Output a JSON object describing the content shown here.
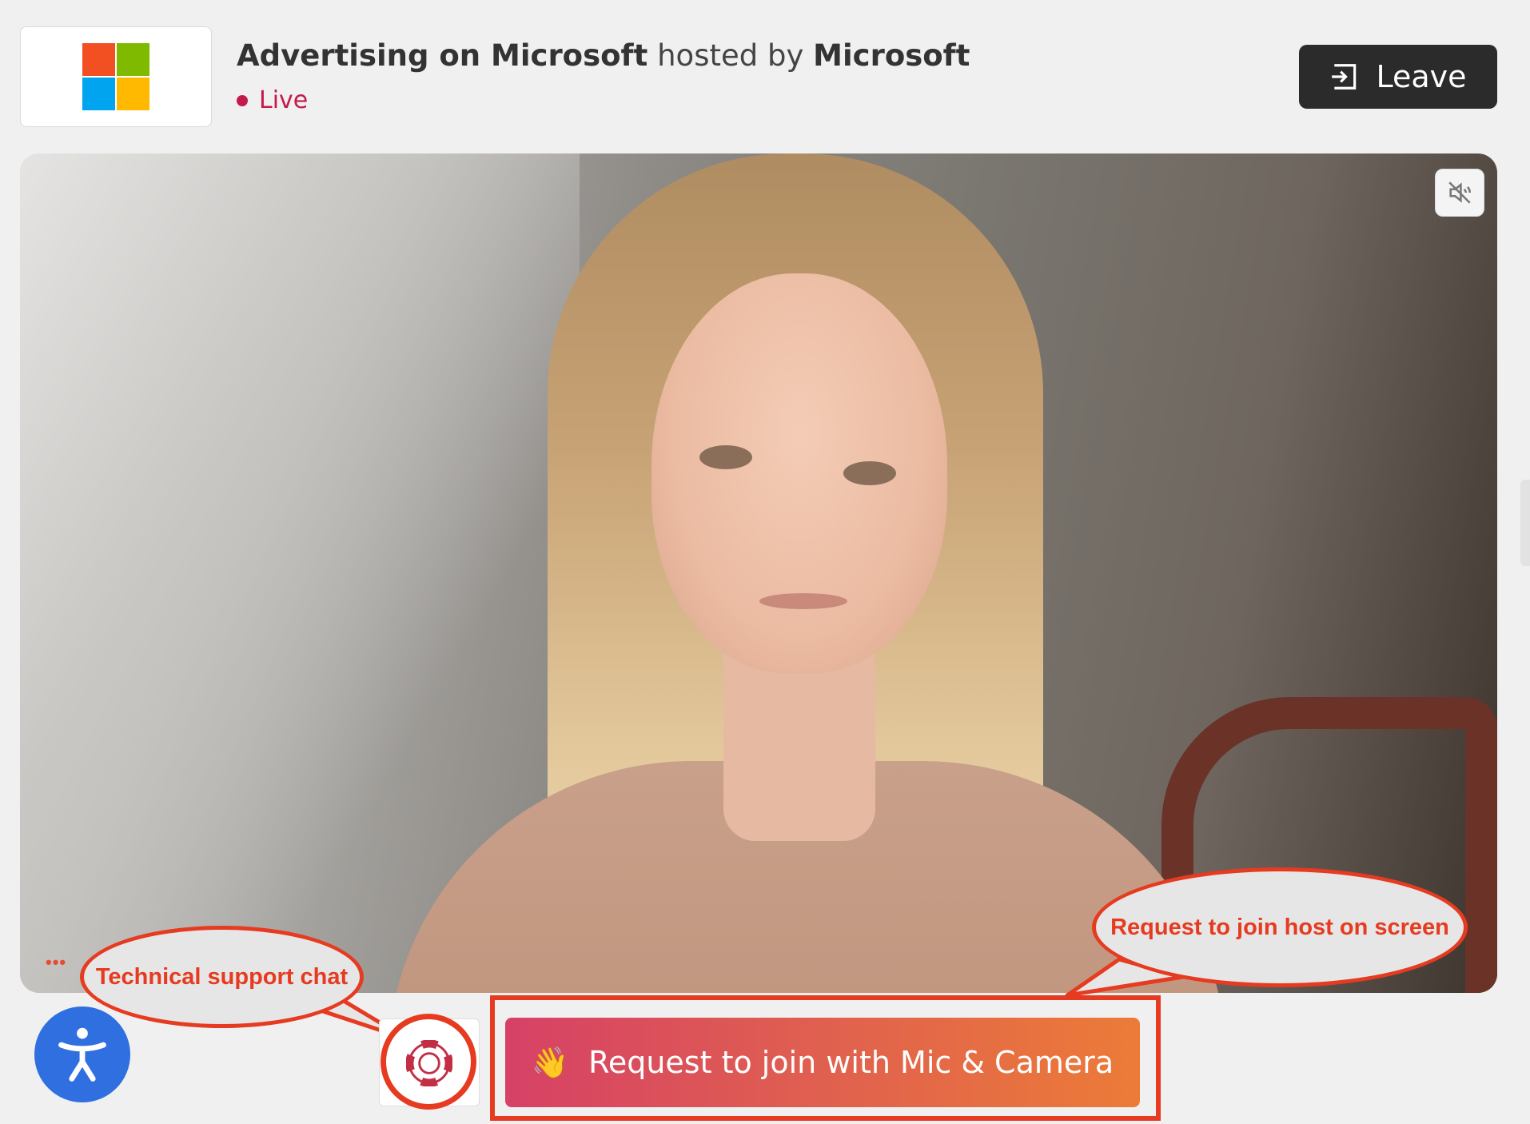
{
  "header": {
    "event_title": "Advertising on Microsoft",
    "hosted_by_text": "hosted by",
    "host_name": "Microsoft",
    "status": "Live",
    "leave_label": "Leave"
  },
  "video": {
    "overflow_dots": "•••"
  },
  "annotations": {
    "support_callout": "Technical support chat",
    "request_callout": "Request to join host on screen"
  },
  "actions": {
    "request_emoji": "👋",
    "request_label": "Request to join with Mic & Camera"
  },
  "colors": {
    "live_red": "#c4194a",
    "leave_bg": "#2b2b2b",
    "annotation_red": "#e63b20",
    "accessibility_blue": "#2f6fe0",
    "request_gradient_start": "#d64166",
    "request_gradient_end": "#ec7b38"
  },
  "icons": {
    "logo": "microsoft-logo",
    "leave": "exit-door-icon",
    "mute": "speaker-muted-icon",
    "accessibility": "accessibility-person-icon",
    "support": "lifebuoy-icon"
  }
}
